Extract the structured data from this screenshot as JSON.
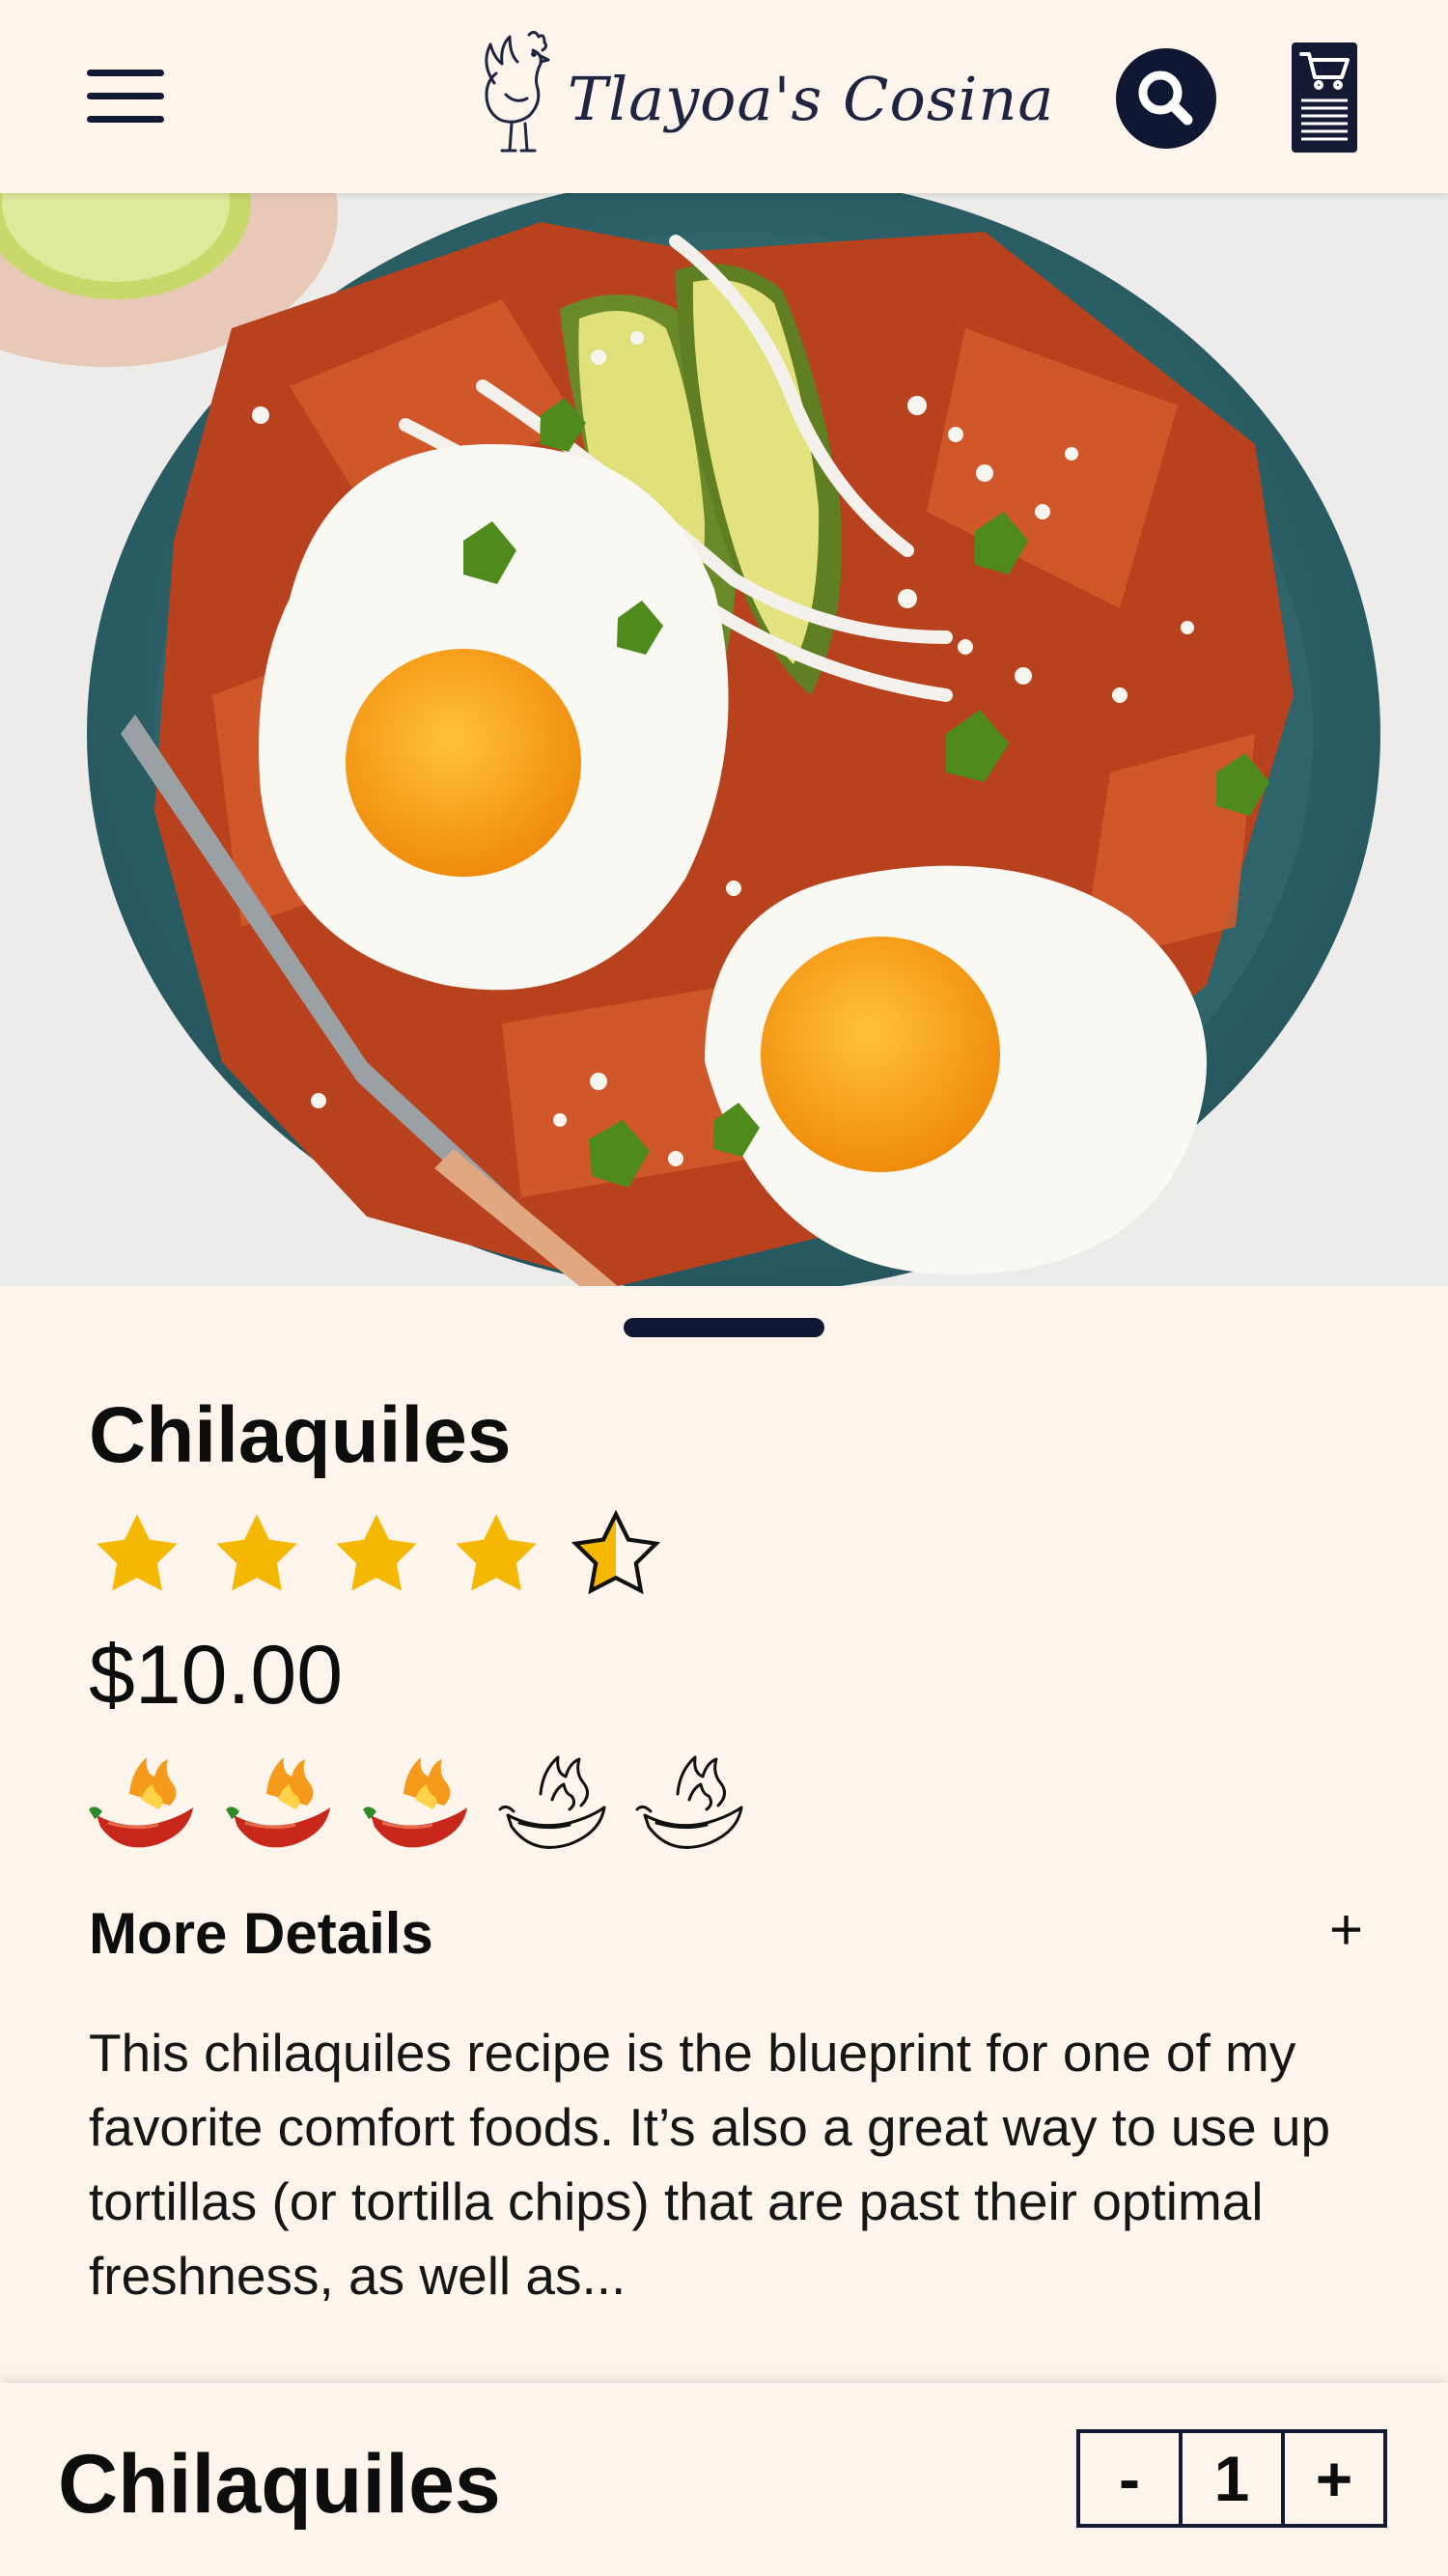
{
  "header": {
    "menu_icon": "hamburger-menu-icon",
    "logo_text": "Tlayoa's Cosina",
    "search_icon": "search-icon",
    "cart_icon": "shopping-cart-icon"
  },
  "product": {
    "name": "Chilaquiles",
    "rating": 4.5,
    "rating_max": 5,
    "price": "$10.00",
    "spice_level": 3,
    "spice_max": 5,
    "details_label": "More Details",
    "details_toggle": "+",
    "description": "This chilaquiles recipe is the blueprint for one of my favorite comfort foods. It’s also a great way to use up tortillas (or tortilla chips) that are past their optimal freshness, as well as..."
  },
  "order_bar": {
    "name": "Chilaquiles",
    "decrement": "-",
    "quantity": "1",
    "increment": "+"
  },
  "colors": {
    "background": "#fdf4ec",
    "navy": "#0f1733",
    "star": "#f5b800",
    "pepper_red": "#c8281c",
    "flame": "#f59a1b"
  }
}
